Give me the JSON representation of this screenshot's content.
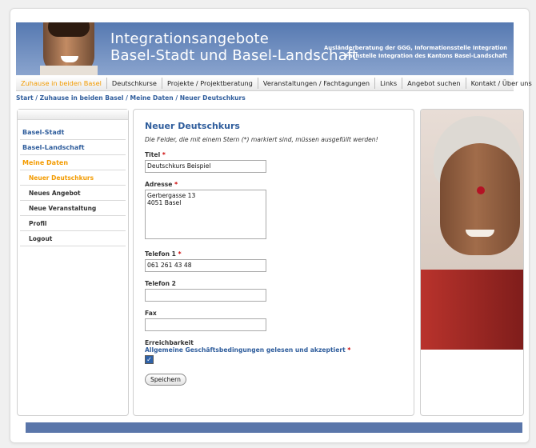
{
  "header": {
    "title_line1": "Integrationsangebote",
    "title_line2": "Basel-Stadt und Basel-Landschaft",
    "subtitle_line1": "Ausländerberatung der GGG, Informationsstelle Integration",
    "subtitle_line2": "Fachstelle Integration des Kantons Basel-Landschaft"
  },
  "nav": {
    "items": [
      "Zuhause in beiden Basel",
      "Deutschkurse",
      "Projekte / Projektberatung",
      "Veranstaltungen / Fachtagungen",
      "Links",
      "Angebot suchen",
      "Kontakt / Über uns"
    ],
    "active_index": 0
  },
  "breadcrumb": "Start / Zuhause in beiden Basel / Meine Daten / Neuer Deutschkurs",
  "sidebar": {
    "items": [
      "Basel-Stadt",
      "Basel-Landschaft",
      "Meine Daten"
    ],
    "subitems": [
      "Neuer Deutschkurs",
      "Neues Angebot",
      "Neue Veranstaltung",
      "Profil",
      "Logout"
    ]
  },
  "form": {
    "heading": "Neuer Deutschkurs",
    "description": "Die Felder, die mit einem Stern (*) markiert sind, müssen ausgefüllt werden!",
    "title_label": "Titel",
    "title_value": "Deutschkurs Beispiel",
    "address_label": "Adresse",
    "address_value": "Gerbergasse 13\n4051 Basel",
    "phone1_label": "Telefon 1",
    "phone1_value": "061 261 43 48",
    "phone2_label": "Telefon 2",
    "phone2_value": "",
    "fax_label": "Fax",
    "fax_value": "",
    "availability_label": "Erreichbarkeit",
    "terms_label": "Allgemeine Geschäftsbedingungen gelesen und akzeptiert",
    "required_mark": "*",
    "save_label": "Speichern",
    "checkbox_checked": true
  }
}
